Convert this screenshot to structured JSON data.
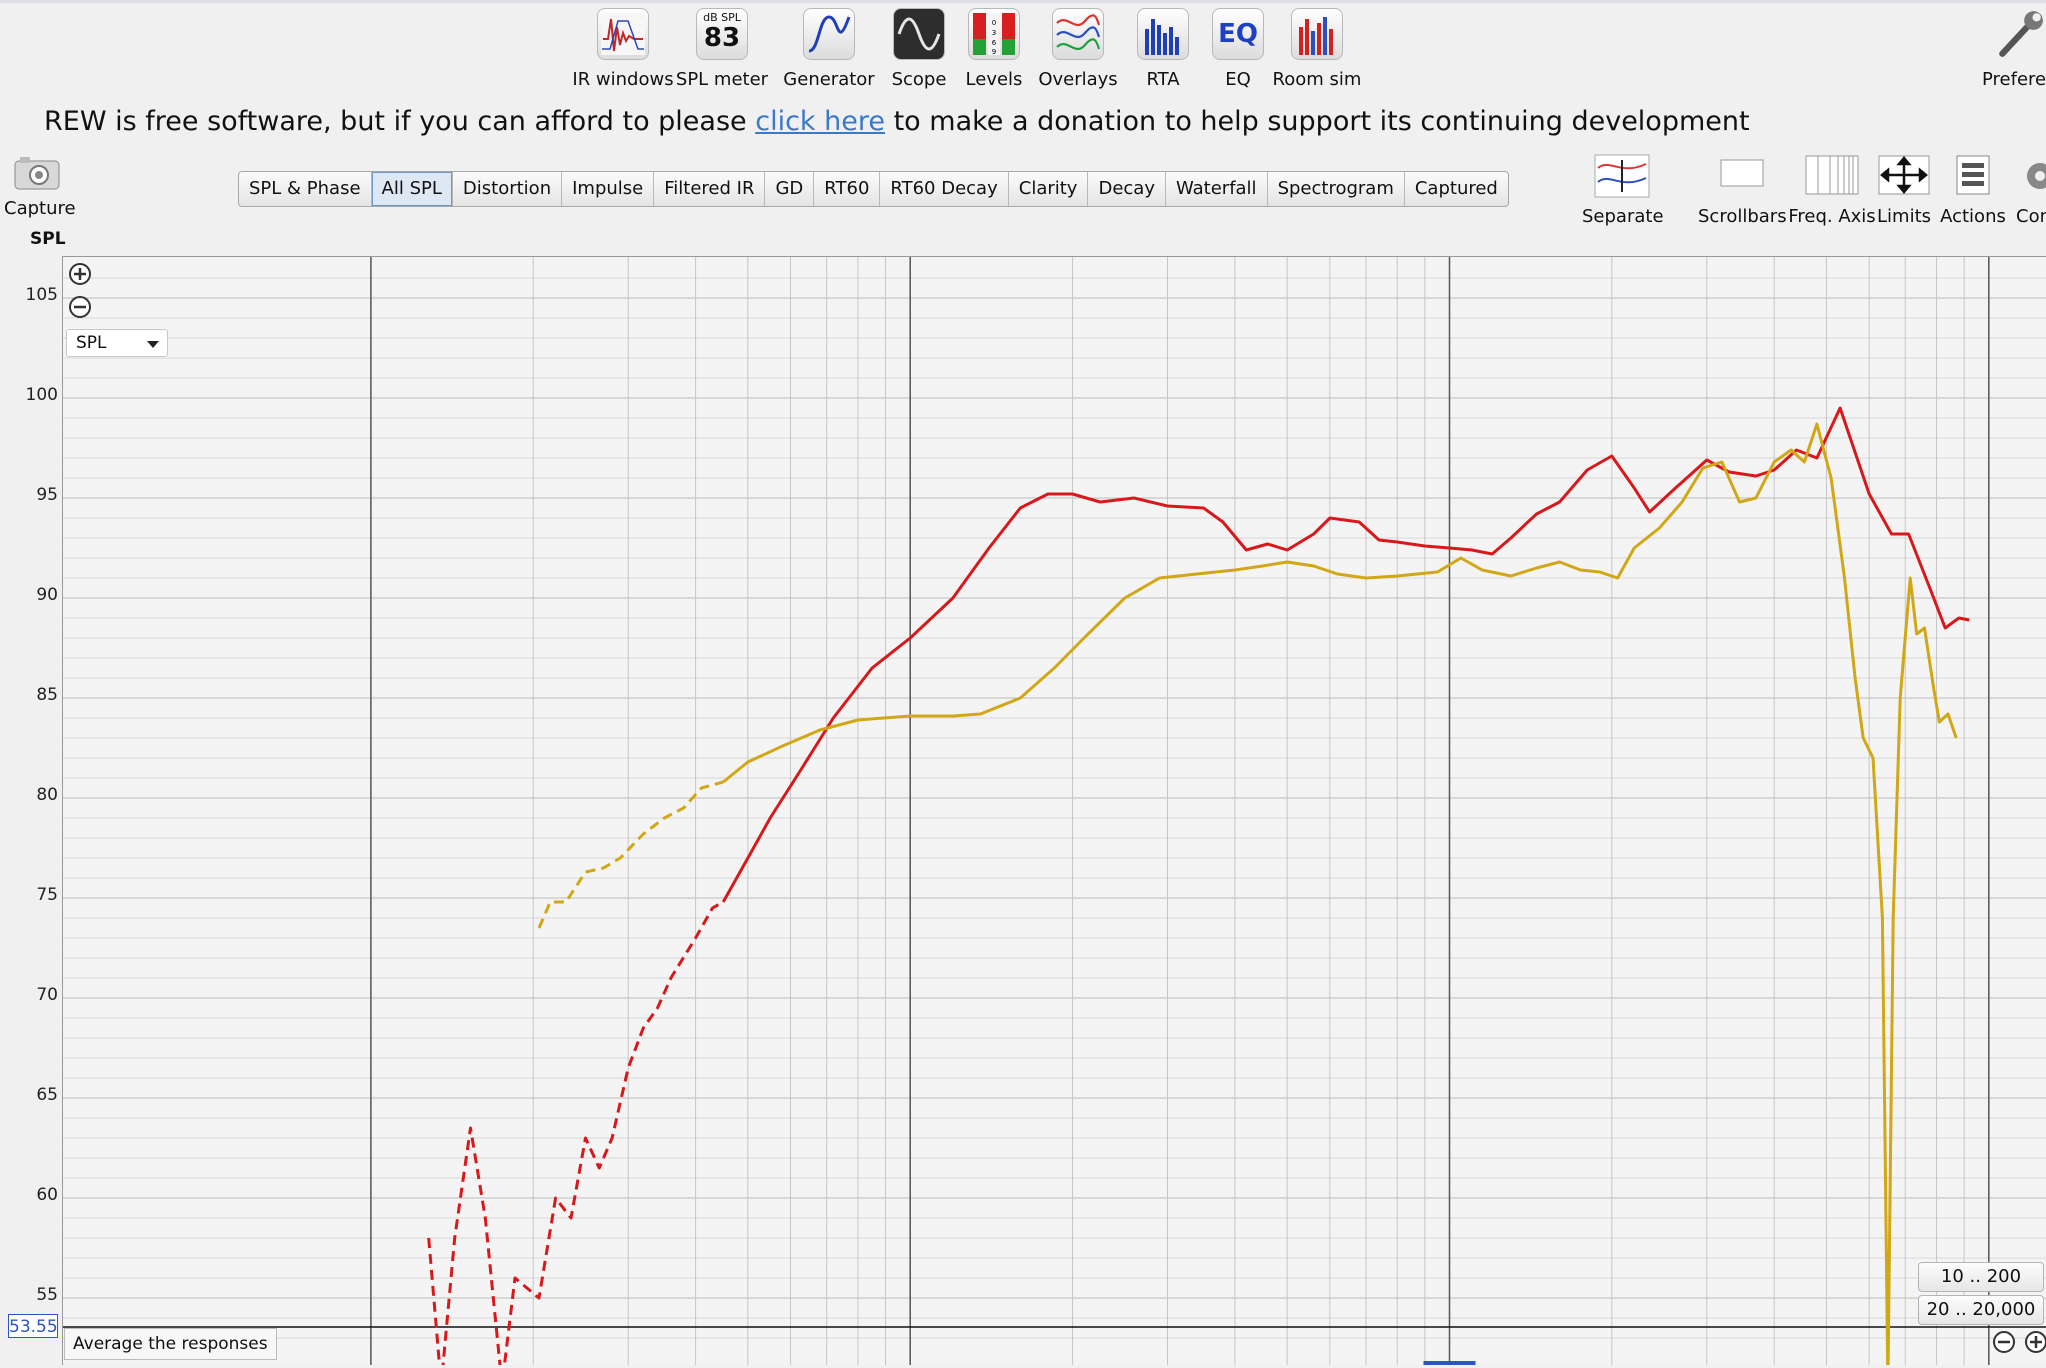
{
  "toolbar": {
    "items": [
      {
        "label": "IR windows",
        "icon": "ir-windows-icon"
      },
      {
        "label": "SPL meter",
        "icon": "spl-meter-icon",
        "icon_top": "dB SPL",
        "icon_value": "83"
      },
      {
        "label": "Generator",
        "icon": "generator-icon"
      },
      {
        "label": "Scope",
        "icon": "scope-icon"
      },
      {
        "label": "Levels",
        "icon": "levels-icon"
      },
      {
        "label": "Overlays",
        "icon": "overlays-icon"
      },
      {
        "label": "RTA",
        "icon": "rta-icon"
      },
      {
        "label": "EQ",
        "icon": "eq-icon",
        "icon_text": "EQ"
      },
      {
        "label": "Room sim",
        "icon": "room-sim-icon"
      }
    ],
    "preferences_label": "Preferen"
  },
  "donation": {
    "before": "REW is free software, but if you can afford to please ",
    "link": "click here",
    "after": " to make a donation to help support its continuing development"
  },
  "capture": {
    "label": "Capture"
  },
  "tabs": [
    "SPL & Phase",
    "All SPL",
    "Distortion",
    "Impulse",
    "Filtered IR",
    "GD",
    "RT60",
    "RT60 Decay",
    "Clarity",
    "Decay",
    "Waterfall",
    "Spectrogram",
    "Captured"
  ],
  "active_tab": "All SPL",
  "right_tools": {
    "separate": "Separate",
    "scrollbars": "Scrollbars",
    "freq_axis": "Freq. Axis",
    "limits": "Limits",
    "actions": "Actions",
    "con": "Con"
  },
  "graph": {
    "y_axis_title": "SPL",
    "select_value": "SPL",
    "cursor_value": "53.55",
    "average_button": "Average the responses",
    "range_buttons": [
      "10 .. 200",
      "20 .. 20,000"
    ]
  },
  "colors": {
    "red_series": "#d8191b",
    "yellow_series": "#d2a716",
    "grid": "#c6c6c6",
    "major_grid": "#555555",
    "accent": "#3b78c9"
  },
  "chart_data": {
    "type": "line",
    "xscale": "log",
    "xlim": [
      10,
      20000
    ],
    "ylim": [
      52.8,
      106.8
    ],
    "yticks": [
      55,
      60,
      65,
      70,
      75,
      80,
      85,
      90,
      95,
      100,
      105
    ],
    "series": [
      {
        "color": "#d8191b",
        "dashed_until_x": 45,
        "points": [
          [
            12.8,
            58
          ],
          [
            13.5,
            50
          ],
          [
            14.3,
            58
          ],
          [
            15.3,
            63.5
          ],
          [
            16.3,
            59
          ],
          [
            17.5,
            48
          ],
          [
            18.5,
            56
          ],
          [
            20.5,
            55
          ],
          [
            22,
            60
          ],
          [
            23.5,
            59
          ],
          [
            25,
            63
          ],
          [
            26.5,
            61.5
          ],
          [
            28,
            63
          ],
          [
            30,
            66.5
          ],
          [
            32,
            68.5
          ],
          [
            34,
            69.5
          ],
          [
            36,
            71
          ],
          [
            40,
            73
          ],
          [
            43,
            74.5
          ],
          [
            45,
            74.8
          ],
          [
            50,
            77
          ],
          [
            55,
            79
          ],
          [
            63,
            81.5
          ],
          [
            72,
            84
          ],
          [
            85,
            86.5
          ],
          [
            100,
            88
          ],
          [
            120,
            90
          ],
          [
            140,
            92.5
          ],
          [
            160,
            94.5
          ],
          [
            180,
            95.2
          ],
          [
            200,
            95.2
          ],
          [
            225,
            94.8
          ],
          [
            260,
            95
          ],
          [
            300,
            94.6
          ],
          [
            350,
            94.5
          ],
          [
            380,
            93.8
          ],
          [
            420,
            92.4
          ],
          [
            460,
            92.7
          ],
          [
            500,
            92.4
          ],
          [
            560,
            93.2
          ],
          [
            600,
            94
          ],
          [
            680,
            93.8
          ],
          [
            740,
            92.9
          ],
          [
            800,
            92.8
          ],
          [
            900,
            92.6
          ],
          [
            1000,
            92.5
          ],
          [
            1100,
            92.4
          ],
          [
            1200,
            92.2
          ],
          [
            1300,
            93
          ],
          [
            1450,
            94.2
          ],
          [
            1600,
            94.8
          ],
          [
            1800,
            96.4
          ],
          [
            2000,
            97.1
          ],
          [
            2200,
            95.5
          ],
          [
            2350,
            94.3
          ],
          [
            2600,
            95.4
          ],
          [
            3000,
            96.9
          ],
          [
            3300,
            96.3
          ],
          [
            3700,
            96.1
          ],
          [
            4000,
            96.4
          ],
          [
            4400,
            97.4
          ],
          [
            4800,
            97
          ],
          [
            5300,
            99.5
          ],
          [
            6000,
            95.2
          ],
          [
            6600,
            93.2
          ],
          [
            7100,
            93.2
          ],
          [
            7800,
            90.4
          ],
          [
            8300,
            88.5
          ],
          [
            8800,
            89
          ],
          [
            9200,
            88.9
          ]
        ]
      },
      {
        "color": "#d2a716",
        "dashed_until_x": 45,
        "points": [
          [
            20.5,
            73.5
          ],
          [
            21.5,
            74.8
          ],
          [
            23,
            74.8
          ],
          [
            25,
            76.3
          ],
          [
            27,
            76.5
          ],
          [
            29,
            77
          ],
          [
            32,
            78.2
          ],
          [
            35,
            79
          ],
          [
            38,
            79.5
          ],
          [
            41,
            80.5
          ],
          [
            45,
            80.8
          ],
          [
            50,
            81.8
          ],
          [
            58,
            82.6
          ],
          [
            68,
            83.4
          ],
          [
            80,
            83.9
          ],
          [
            100,
            84.1
          ],
          [
            120,
            84.1
          ],
          [
            135,
            84.2
          ],
          [
            160,
            85
          ],
          [
            185,
            86.5
          ],
          [
            210,
            88
          ],
          [
            250,
            90
          ],
          [
            290,
            91
          ],
          [
            340,
            91.2
          ],
          [
            400,
            91.4
          ],
          [
            450,
            91.6
          ],
          [
            500,
            91.8
          ],
          [
            560,
            91.6
          ],
          [
            620,
            91.2
          ],
          [
            700,
            91
          ],
          [
            800,
            91.1
          ],
          [
            950,
            91.3
          ],
          [
            1050,
            92
          ],
          [
            1150,
            91.4
          ],
          [
            1300,
            91.1
          ],
          [
            1450,
            91.5
          ],
          [
            1600,
            91.8
          ],
          [
            1750,
            91.4
          ],
          [
            1900,
            91.3
          ],
          [
            2050,
            91
          ],
          [
            2200,
            92.5
          ],
          [
            2450,
            93.5
          ],
          [
            2700,
            94.8
          ],
          [
            2950,
            96.5
          ],
          [
            3200,
            96.8
          ],
          [
            3450,
            94.8
          ],
          [
            3700,
            95
          ],
          [
            4000,
            96.8
          ],
          [
            4300,
            97.4
          ],
          [
            4550,
            96.8
          ],
          [
            4800,
            98.7
          ],
          [
            5100,
            96
          ],
          [
            5400,
            91
          ],
          [
            5650,
            86
          ],
          [
            5850,
            83
          ],
          [
            6100,
            82
          ],
          [
            6350,
            74
          ],
          [
            6500,
            50
          ],
          [
            6650,
            74
          ],
          [
            6850,
            85
          ],
          [
            7150,
            91
          ],
          [
            7350,
            88.2
          ],
          [
            7600,
            88.5
          ],
          [
            7900,
            85.5
          ],
          [
            8100,
            83.8
          ],
          [
            8400,
            84.2
          ],
          [
            8700,
            83
          ]
        ]
      }
    ]
  }
}
